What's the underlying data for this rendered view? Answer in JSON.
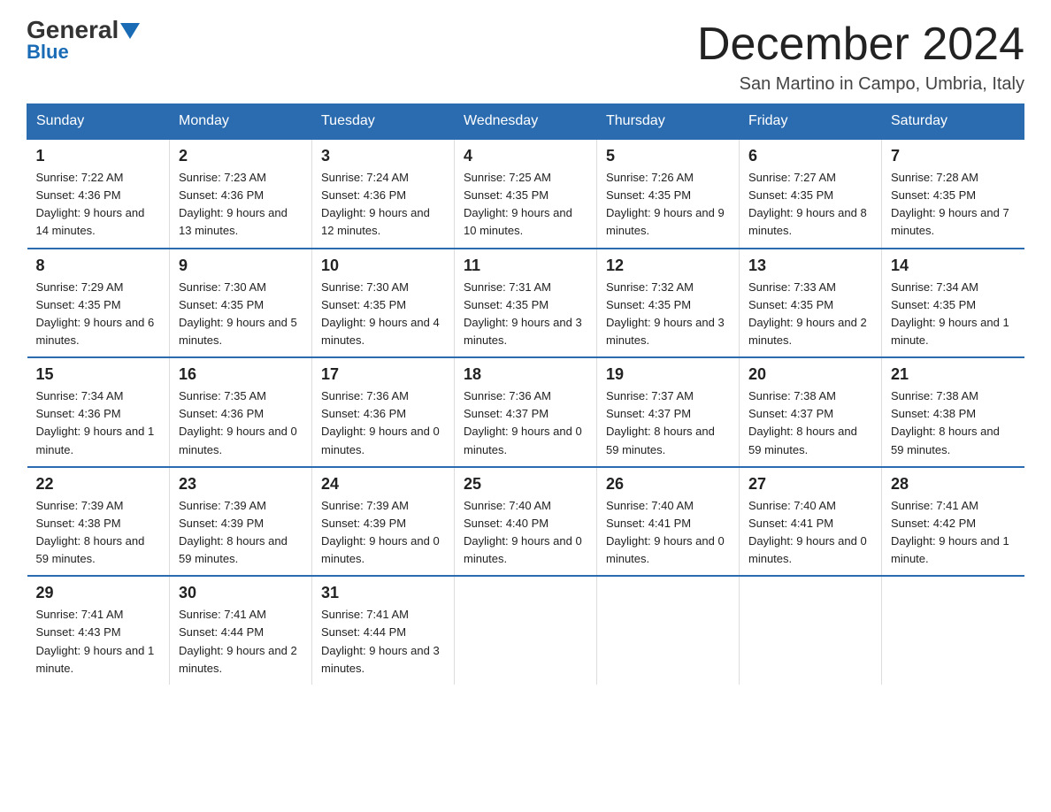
{
  "logo": {
    "text1": "General",
    "text2": "Blue"
  },
  "title": "December 2024",
  "subtitle": "San Martino in Campo, Umbria, Italy",
  "days_header": [
    "Sunday",
    "Monday",
    "Tuesday",
    "Wednesday",
    "Thursday",
    "Friday",
    "Saturday"
  ],
  "weeks": [
    [
      {
        "num": "1",
        "sunrise": "7:22 AM",
        "sunset": "4:36 PM",
        "daylight": "9 hours and 14 minutes."
      },
      {
        "num": "2",
        "sunrise": "7:23 AM",
        "sunset": "4:36 PM",
        "daylight": "9 hours and 13 minutes."
      },
      {
        "num": "3",
        "sunrise": "7:24 AM",
        "sunset": "4:36 PM",
        "daylight": "9 hours and 12 minutes."
      },
      {
        "num": "4",
        "sunrise": "7:25 AM",
        "sunset": "4:35 PM",
        "daylight": "9 hours and 10 minutes."
      },
      {
        "num": "5",
        "sunrise": "7:26 AM",
        "sunset": "4:35 PM",
        "daylight": "9 hours and 9 minutes."
      },
      {
        "num": "6",
        "sunrise": "7:27 AM",
        "sunset": "4:35 PM",
        "daylight": "9 hours and 8 minutes."
      },
      {
        "num": "7",
        "sunrise": "7:28 AM",
        "sunset": "4:35 PM",
        "daylight": "9 hours and 7 minutes."
      }
    ],
    [
      {
        "num": "8",
        "sunrise": "7:29 AM",
        "sunset": "4:35 PM",
        "daylight": "9 hours and 6 minutes."
      },
      {
        "num": "9",
        "sunrise": "7:30 AM",
        "sunset": "4:35 PM",
        "daylight": "9 hours and 5 minutes."
      },
      {
        "num": "10",
        "sunrise": "7:30 AM",
        "sunset": "4:35 PM",
        "daylight": "9 hours and 4 minutes."
      },
      {
        "num": "11",
        "sunrise": "7:31 AM",
        "sunset": "4:35 PM",
        "daylight": "9 hours and 3 minutes."
      },
      {
        "num": "12",
        "sunrise": "7:32 AM",
        "sunset": "4:35 PM",
        "daylight": "9 hours and 3 minutes."
      },
      {
        "num": "13",
        "sunrise": "7:33 AM",
        "sunset": "4:35 PM",
        "daylight": "9 hours and 2 minutes."
      },
      {
        "num": "14",
        "sunrise": "7:34 AM",
        "sunset": "4:35 PM",
        "daylight": "9 hours and 1 minute."
      }
    ],
    [
      {
        "num": "15",
        "sunrise": "7:34 AM",
        "sunset": "4:36 PM",
        "daylight": "9 hours and 1 minute."
      },
      {
        "num": "16",
        "sunrise": "7:35 AM",
        "sunset": "4:36 PM",
        "daylight": "9 hours and 0 minutes."
      },
      {
        "num": "17",
        "sunrise": "7:36 AM",
        "sunset": "4:36 PM",
        "daylight": "9 hours and 0 minutes."
      },
      {
        "num": "18",
        "sunrise": "7:36 AM",
        "sunset": "4:37 PM",
        "daylight": "9 hours and 0 minutes."
      },
      {
        "num": "19",
        "sunrise": "7:37 AM",
        "sunset": "4:37 PM",
        "daylight": "8 hours and 59 minutes."
      },
      {
        "num": "20",
        "sunrise": "7:38 AM",
        "sunset": "4:37 PM",
        "daylight": "8 hours and 59 minutes."
      },
      {
        "num": "21",
        "sunrise": "7:38 AM",
        "sunset": "4:38 PM",
        "daylight": "8 hours and 59 minutes."
      }
    ],
    [
      {
        "num": "22",
        "sunrise": "7:39 AM",
        "sunset": "4:38 PM",
        "daylight": "8 hours and 59 minutes."
      },
      {
        "num": "23",
        "sunrise": "7:39 AM",
        "sunset": "4:39 PM",
        "daylight": "8 hours and 59 minutes."
      },
      {
        "num": "24",
        "sunrise": "7:39 AM",
        "sunset": "4:39 PM",
        "daylight": "9 hours and 0 minutes."
      },
      {
        "num": "25",
        "sunrise": "7:40 AM",
        "sunset": "4:40 PM",
        "daylight": "9 hours and 0 minutes."
      },
      {
        "num": "26",
        "sunrise": "7:40 AM",
        "sunset": "4:41 PM",
        "daylight": "9 hours and 0 minutes."
      },
      {
        "num": "27",
        "sunrise": "7:40 AM",
        "sunset": "4:41 PM",
        "daylight": "9 hours and 0 minutes."
      },
      {
        "num": "28",
        "sunrise": "7:41 AM",
        "sunset": "4:42 PM",
        "daylight": "9 hours and 1 minute."
      }
    ],
    [
      {
        "num": "29",
        "sunrise": "7:41 AM",
        "sunset": "4:43 PM",
        "daylight": "9 hours and 1 minute."
      },
      {
        "num": "30",
        "sunrise": "7:41 AM",
        "sunset": "4:44 PM",
        "daylight": "9 hours and 2 minutes."
      },
      {
        "num": "31",
        "sunrise": "7:41 AM",
        "sunset": "4:44 PM",
        "daylight": "9 hours and 3 minutes."
      },
      null,
      null,
      null,
      null
    ]
  ]
}
